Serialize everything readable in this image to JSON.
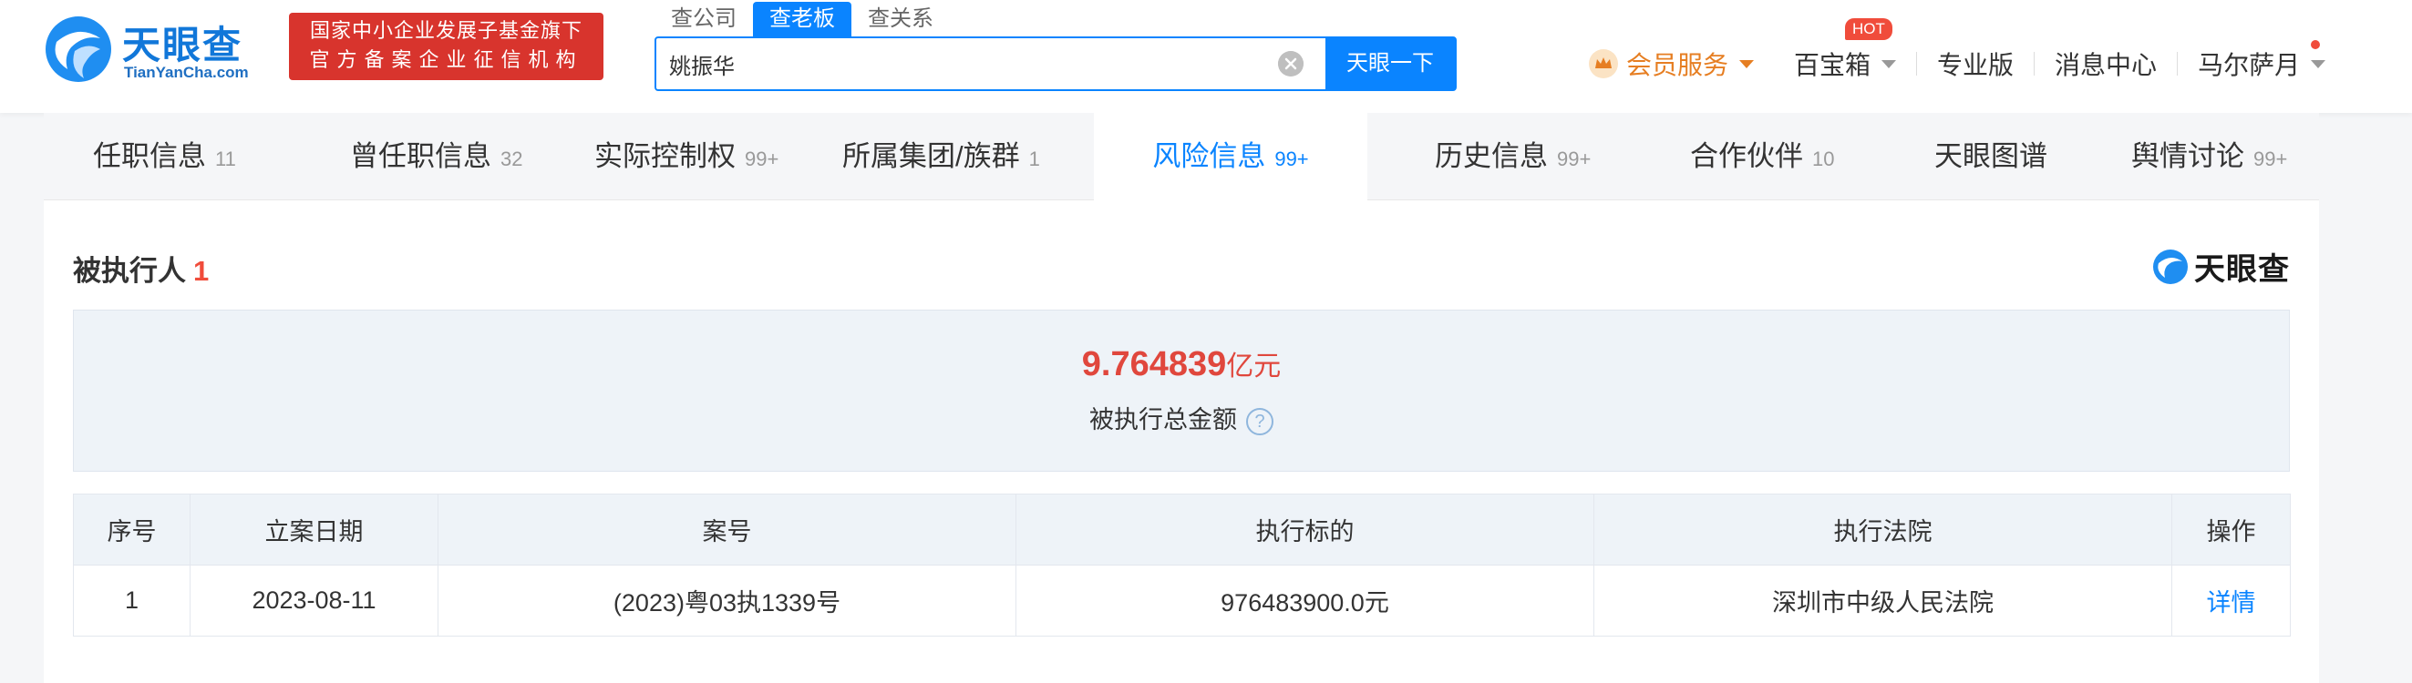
{
  "header": {
    "logo_text": "天眼查",
    "logo_sub": "TianYanCha.com",
    "badge_line1": "国家中小企业发展子基金旗下",
    "badge_line2": "官方备案企业征信机构",
    "search_tabs": [
      "查公司",
      "查老板",
      "查关系"
    ],
    "search_value": "姚振华",
    "search_button": "天眼一下",
    "nav": {
      "vip": "会员服务",
      "baobaoxiang": "百宝箱",
      "hot": "HOT",
      "pro": "专业版",
      "messages": "消息中心",
      "user": "马尔萨月"
    }
  },
  "tabs": [
    {
      "label": "任职信息",
      "count": "11"
    },
    {
      "label": "曾任职信息",
      "count": "32"
    },
    {
      "label": "实际控制权",
      "count": "99+"
    },
    {
      "label": "所属集团/族群",
      "count": "1"
    },
    {
      "label": "风险信息",
      "count": "99+"
    },
    {
      "label": "历史信息",
      "count": "99+"
    },
    {
      "label": "合作伙伴",
      "count": "10"
    },
    {
      "label": "天眼图谱",
      "count": ""
    },
    {
      "label": "舆情讨论",
      "count": "99+"
    }
  ],
  "section": {
    "title": "被执行人",
    "count": "1",
    "watermark": "天眼查",
    "summary_value": "9.764839",
    "summary_unit": "亿元",
    "summary_label": "被执行总金额",
    "help": "?"
  },
  "table": {
    "headers": [
      "序号",
      "立案日期",
      "案号",
      "执行标的",
      "执行法院",
      "操作"
    ],
    "rows": [
      [
        "1",
        "2023-08-11",
        "(2023)粤03执1339号",
        "976483900.0元",
        "深圳市中级人民法院",
        "详情"
      ]
    ]
  },
  "colors": {
    "brand_blue": "#0a84ff",
    "accent_red": "#e0473d",
    "vip_orange": "#e67e22"
  }
}
